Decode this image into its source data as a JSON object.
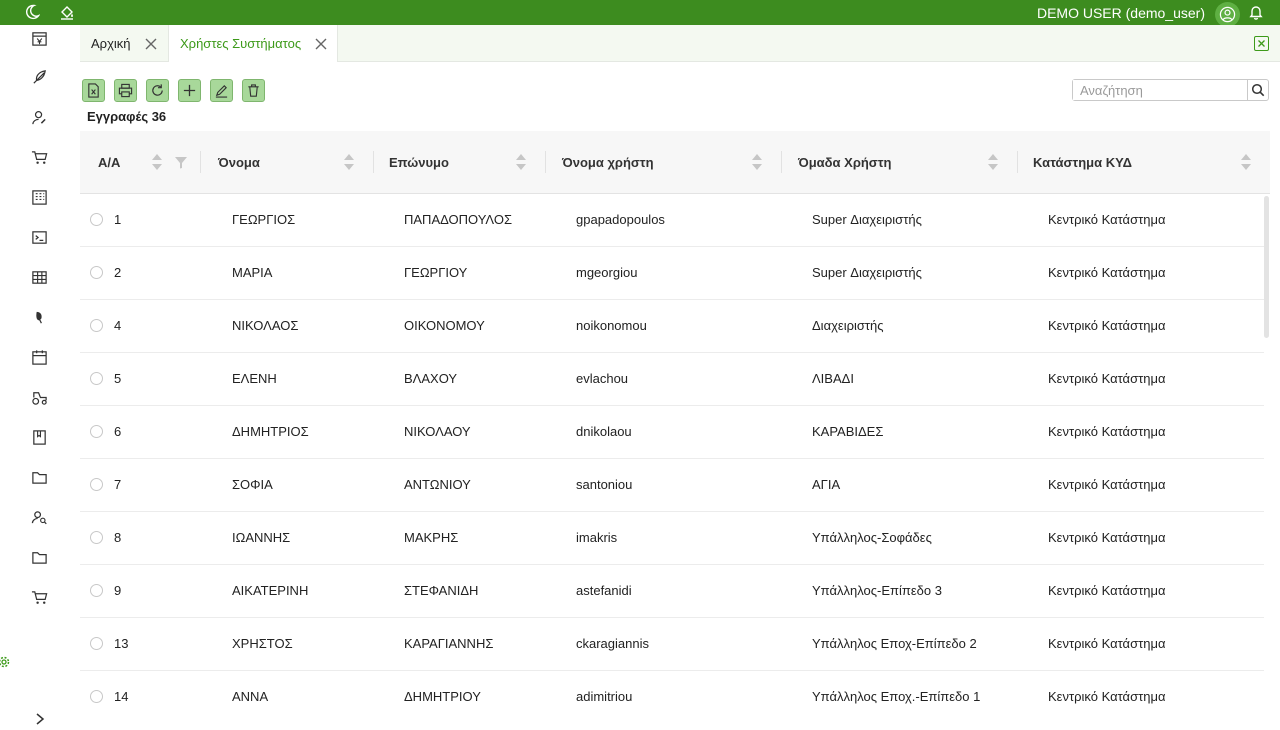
{
  "topbar": {
    "user_label": "DEMO USER (demo_user)",
    "color": "#3d8c1f"
  },
  "sidebar": {
    "icons": [
      "calendar-yen-icon",
      "feather-icon",
      "user-edit-icon",
      "cart-icon",
      "building-icon",
      "terminal-icon",
      "table-grid-icon",
      "leaf-icon",
      "calendar-icon",
      "tractor-icon",
      "book-icon",
      "folder-icon",
      "users-search-icon",
      "folder-icon",
      "cart-icon"
    ]
  },
  "tabs": [
    {
      "label": "Αρχική",
      "active": false
    },
    {
      "label": "Χρήστες Συστήματος",
      "active": true
    }
  ],
  "toolbar": {
    "buttons": [
      "export-excel",
      "print",
      "refresh",
      "add",
      "edit",
      "delete"
    ]
  },
  "search": {
    "placeholder": "Αναζήτηση",
    "value": ""
  },
  "records_label": "Εγγραφές 36",
  "table": {
    "headers": [
      "Α/Α",
      "Όνομα",
      "Επώνυμο",
      "Όνομα χρήστη",
      "Όμαδα Χρήστη",
      "Κατάστημα ΚΥΔ"
    ],
    "rows": [
      [
        "1",
        "ΓΕΩΡΓΙΟΣ",
        "ΠΑΠΑΔΟΠΟΥΛΟΣ",
        "gpapadopoulos",
        "Super Διαχειριστής",
        "Κεντρικό Κατάστημα"
      ],
      [
        "2",
        "ΜΑΡΙΑ",
        "ΓΕΩΡΓΙΟΥ",
        "mgeorgiou",
        "Super Διαχειριστής",
        "Κεντρικό Κατάστημα"
      ],
      [
        "4",
        "ΝΙΚΟΛΑΟΣ",
        "ΟΙΚΟΝΟΜΟΥ",
        "noikonomou",
        "Διαχειριστής",
        "Κεντρικό Κατάστημα"
      ],
      [
        "5",
        "ΕΛΕΝΗ",
        "ΒΛΑΧΟΥ",
        "evlachou",
        "ΛΙΒΑΔΙ",
        "Κεντρικό Κατάστημα"
      ],
      [
        "6",
        "ΔΗΜΗΤΡΙΟΣ",
        "ΝΙΚΟΛΑΟΥ",
        "dnikolaou",
        "ΚΑΡΑΒΙΔΕΣ",
        "Κεντρικό Κατάστημα"
      ],
      [
        "7",
        "ΣΟΦΙΑ",
        "ΑΝΤΩΝΙΟΥ",
        "santoniou",
        "ΑΓΙΑ",
        "Κεντρικό Κατάστημα"
      ],
      [
        "8",
        "ΙΩΑΝΝΗΣ",
        "ΜΑΚΡΗΣ",
        "imakris",
        "Υπάλληλος-Σοφάδες",
        "Κεντρικό Κατάστημα"
      ],
      [
        "9",
        "ΑΙΚΑΤΕΡΙΝΗ",
        "ΣΤΕΦΑΝΙΔΗ",
        "astefanidi",
        "Υπάλληλος-Επίπεδο 3",
        "Κεντρικό Κατάστημα"
      ],
      [
        "13",
        "ΧΡΗΣΤΟΣ",
        "ΚΑΡΑΓΙΑΝΝΗΣ",
        "ckaragiannis",
        "Υπάλληλος Εποχ-Επίπεδο 2",
        "Κεντρικό Κατάστημα"
      ],
      [
        "14",
        "ΑΝΝΑ",
        "ΔΗΜΗΤΡΙΟΥ",
        "adimitriou",
        "Υπάλληλος Εποχ.-Επίπεδο 1",
        "Κεντρικό Κατάστημα"
      ]
    ]
  }
}
